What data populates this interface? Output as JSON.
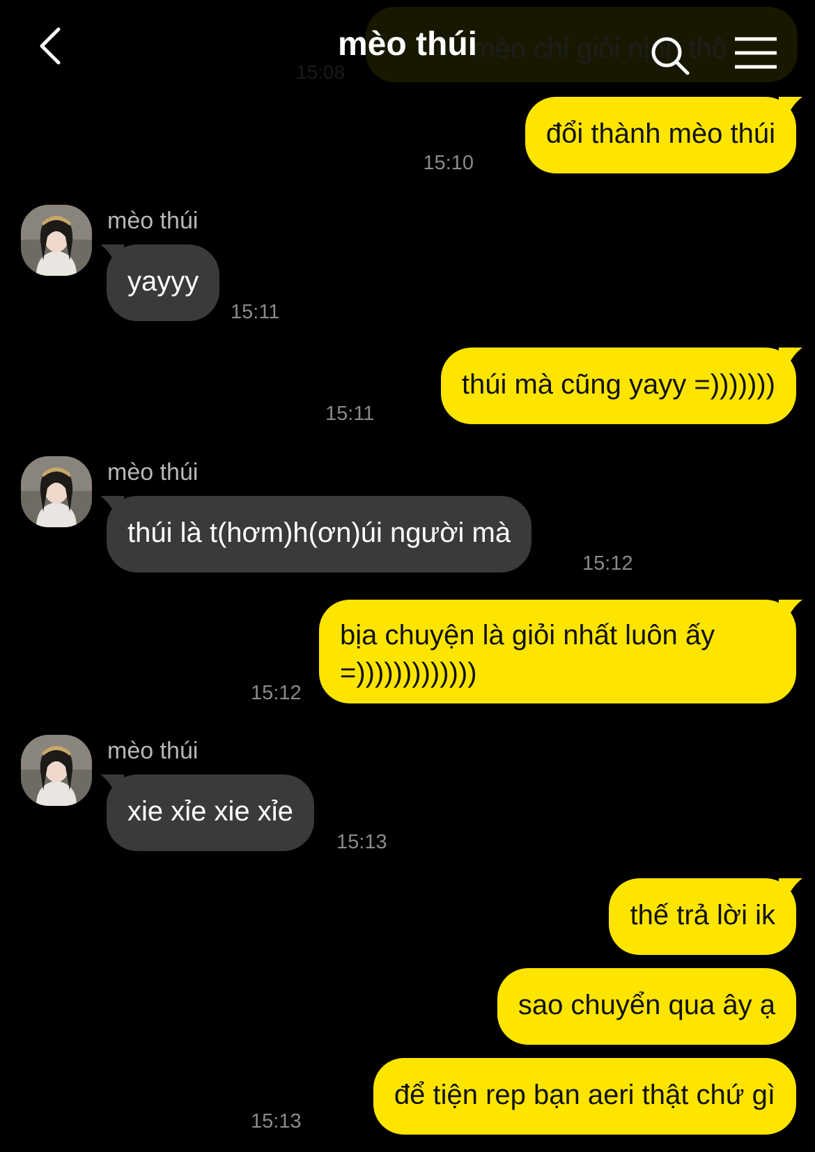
{
  "header": {
    "title": "mèo thúi",
    "icons": {
      "back": "chevron-left-icon",
      "search": "search-icon",
      "menu": "hamburger-menu-icon"
    }
  },
  "colors": {
    "background": "#000000",
    "outgoing_bubble": "#fee500",
    "incoming_bubble": "#3a3a3c",
    "timestamp": "#8a8a8e"
  },
  "chat": {
    "partial_message": {
      "text": "mèo chỉ giỏi nịnh thô",
      "time": "15:08"
    },
    "messages": [
      {
        "direction": "out",
        "text": "đổi thành mèo thúi",
        "time": "15:10"
      },
      {
        "direction": "in",
        "sender": "mèo thúi",
        "text": "yayyy",
        "time": "15:11"
      },
      {
        "direction": "out",
        "text": "thúi mà cũng yayy =)))))))",
        "time": "15:11"
      },
      {
        "direction": "in",
        "sender": "mèo thúi",
        "text": "thúi là t(hơm)h(ơn)úi người mà",
        "time": "15:12"
      },
      {
        "direction": "out",
        "text": "bịa chuyện là giỏi nhất luôn ấy =)))))))))))))",
        "time": "15:12"
      },
      {
        "direction": "in",
        "sender": "mèo thúi",
        "text": "xie xỉe xie xỉe",
        "time": "15:13"
      },
      {
        "direction": "out",
        "text": "thế trả lời ik"
      },
      {
        "direction": "out",
        "text": "sao chuyển qua ây ạ"
      },
      {
        "direction": "out",
        "text": "để tiện rep bạn aeri thật chứ gì",
        "time": "15:13"
      }
    ]
  }
}
